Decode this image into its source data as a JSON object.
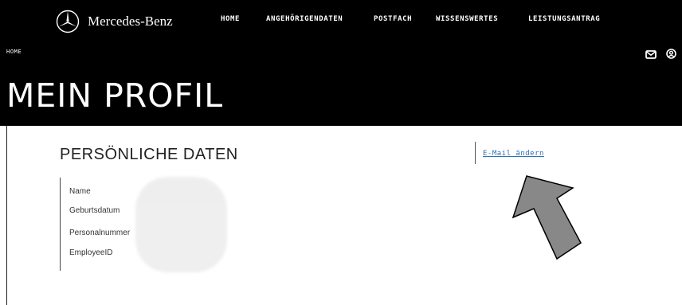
{
  "brand": {
    "name": "Mercedes-Benz"
  },
  "nav": {
    "items": [
      {
        "label": "HOME"
      },
      {
        "label": "ANGEHÖRIGENDATEN"
      },
      {
        "label": "POSTFACH"
      },
      {
        "label": "WISSENSWERTES"
      },
      {
        "label": "LEISTUNGSANTRAG"
      }
    ]
  },
  "breadcrumb": {
    "label": "HOME"
  },
  "header_icons": {
    "mail": "mail-icon",
    "user": "user-icon"
  },
  "page": {
    "title": "MEIN PROFIL"
  },
  "personal_data": {
    "title": "PERSÖNLICHE DATEN",
    "fields": [
      {
        "label": "Name"
      },
      {
        "label": "Geburtsdatum"
      },
      {
        "label": "Personalnummer"
      },
      {
        "label": "EmployeeID"
      }
    ]
  },
  "actions": {
    "change_email": "E-Mail ändern"
  },
  "annotation": {
    "arrow": "arrow-icon",
    "color": "#888888"
  },
  "colors": {
    "header_bg": "#000000",
    "link": "#2f6fb3",
    "text": "#222222"
  }
}
